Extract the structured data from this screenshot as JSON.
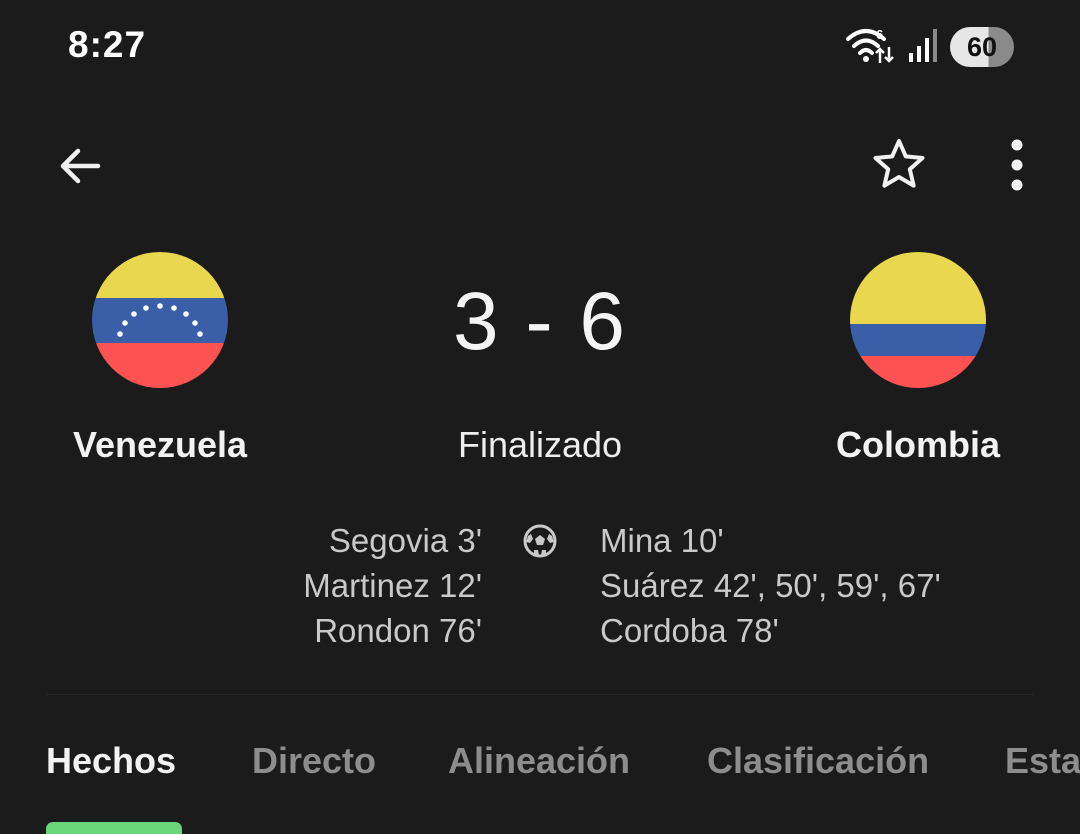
{
  "status_bar": {
    "time": "8:27",
    "battery": "60",
    "icons": [
      "wifi-6-icon",
      "signal-icon",
      "battery-icon"
    ]
  },
  "top_bar": {
    "icons": [
      "back-arrow-icon",
      "star-outline-icon",
      "more-vert-icon"
    ]
  },
  "match": {
    "home_team": "Venezuela",
    "away_team": "Colombia",
    "score": "3 - 6",
    "status": "Finalizado",
    "home_scorers": [
      "Segovia 3'",
      "Martinez 12'",
      "Rondon 76'"
    ],
    "away_scorers": [
      "Mina 10'",
      "Suárez 42', 50', 59', 67'",
      "Cordoba 78'"
    ],
    "goal_icon": "soccer-ball-icon"
  },
  "flags": {
    "venezuela": {
      "yellow": "#e9d84e",
      "blue": "#3b5ea9",
      "red": "#fc5252",
      "stars": "#ffffff"
    },
    "colombia": {
      "yellow": "#e9d84e",
      "blue": "#3b5ea9",
      "red": "#fc5252"
    }
  },
  "tabs": {
    "items": [
      "Hechos",
      "Directo",
      "Alineación",
      "Clasificación",
      "Esta"
    ],
    "active": "Hechos",
    "accent": "#6ad67a"
  }
}
